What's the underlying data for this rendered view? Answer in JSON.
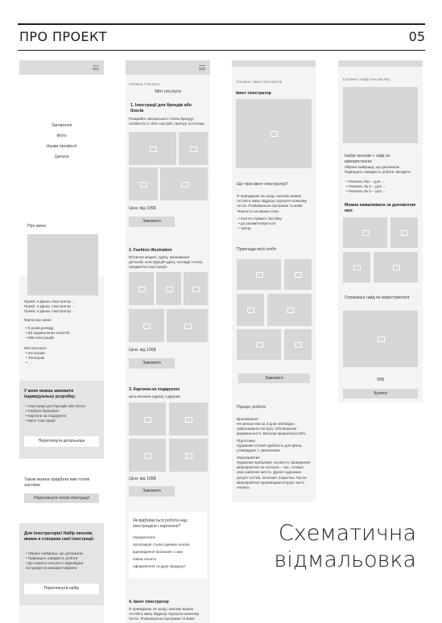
{
  "header": {
    "title": "ПРО ПРОЕКТ",
    "page_number": "05"
  },
  "caption": {
    "line1": "Схематична",
    "line2": "відмальовка"
  },
  "mock1": {
    "nav": [
      "Заговолок",
      "Фото",
      "Назва професії",
      "Цитата"
    ],
    "about_title": "Про мене",
    "about_lines": [
      "Привіт, я Даша, ілюстратор ...",
      "Привіт, я Даша, ілюстратор ...",
      "Привіт, я Даша, ілюстратор ..."
    ],
    "facts_title": "Факти про мене",
    "facts": [
      "5 років досвіду",
      "56 задоволених клієнтів",
      "555 ілюстрацій"
    ],
    "contacts_title": "Мої контакти",
    "contacts": [
      "Інстаграм",
      "Телеграм",
      "..."
    ],
    "order_title": "У мене можна замовити індивідуальну розробку:",
    "order_items": [
      "Ілюстрації для брендів або блога",
      "Fashion illustration",
      "Картини на подарунок",
      "Івент ілюстрації"
    ],
    "order_btn": "Переглянути детальніше",
    "ready_title": "Також можна придбати вже готові листівки",
    "ready_btn": "Переглянути готові ілюстрації",
    "kit_title": "Для ілюстраторів! Набір пензлів, якими я створюю свої ілюстрації.",
    "kit_items": [
      "Зібрані найкращі, що допомагає",
      "Підвищить швидкість роботи",
      "До кожного пензлю є відповідна інструкція як використовувати"
    ],
    "kit_btn": "Переглянути набір"
  },
  "mock2": {
    "breadcrumb": "Головна / послуги",
    "title": "Мої послуги",
    "s1_title": "1. Ілюстрації для брендів або блогів",
    "s1_text": "Розкрийте авторського стилю бренду/ особистості, його настрій, палітру та почерк.",
    "s1_price": "Ціна: від 199$",
    "s2_title": "2. Fashion illustration",
    "s2_text": "Втілення моделі, одягу, малювання деталей, конструкцій одягу, погляди стилю, предметна ілюстрація.",
    "s2_price": "Ціна: від 199$",
    "s3_title": "3. Картина на подарунок",
    "s3_text": "Ціна вказана одразу з друком.",
    "s3_price": "Ціна: від 199$",
    "order_btn": "Замовити",
    "process_title": "Як відбувається робота над ілюстрацією і картиною?",
    "process_steps": [
      "передоплата",
      "пропозиція стилю ідейних ескізів",
      "відповідення прохання з ним",
      "повна оплата",
      "оформлення та друк продукції"
    ],
    "s4_title": "4. Івент ілюстратор",
    "s4_text": "Я приїжджаю на захід і малюю ваших гостей в живу. Відразу портрети кожному гостю. Розважальна програма та живе творчість на ваших очах."
  },
  "mock3": {
    "breadcrumb": "Головна / Івент ілюстратор",
    "title": "Івент ілюстратор",
    "what_title": "Що таке івент ілюстратор?",
    "what_text": "Я приїжджаю на захід і малюю ваших гостей в живу. Відразу портрети кожному гостю. Розважальна програма та живе творчість на ваших очах.",
    "bullets": [
      "скетчи стрімкої листівку",
      "до запам'ятовується",
      "тренд"
    ],
    "examples_title": "Приклади моїх робіт",
    "order_btn": "Замовити",
    "proc_title": "Процес роботи",
    "proc1_title": "Бронювання",
    "proc1_text": "Не менше ніж за 3 днів необхідно забронювати послугу. Обговорюєм формальності. Вносим предоплату 50%.",
    "proc2_title": "Підготовка",
    "proc2_text": "Художник готовит дибласть для фона, утверждает с заказчиком.",
    "proc3_title": "Мероприятие",
    "proc3_text": "Художник пребывает на место проведения мероприятия за полчаса – час, готовит свое рабочее место. Далее художник рисует гостей, печатает открытки. После мероприятия производим вторую часть оплаты."
  },
  "mock4": {
    "breadcrumb": "Головна / набір пензлів №1",
    "title": "Набір пензлів + гайд по використанню",
    "text": "Зібрані найкращі, що допомагає. Підвищить швидкість роботи. Входить:",
    "items": [
      "Пензель №1 – для ...",
      "Пензель № 2 – для ...",
      "Пензель № 3 – для ..."
    ],
    "draw_title": "Можна намалювати за допомогою них:",
    "guide_title": "Отримаєш гайд як користуватися:",
    "price": "99$",
    "buy_btn": "Купити"
  }
}
